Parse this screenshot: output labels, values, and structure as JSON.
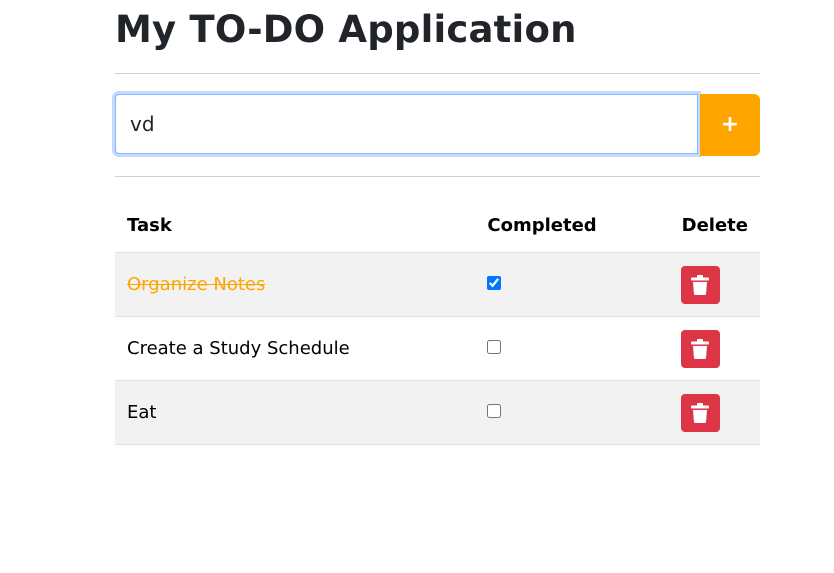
{
  "app": {
    "title": "My TO-DO Application"
  },
  "form": {
    "input_value": "vd",
    "add_label": "+"
  },
  "table": {
    "headers": {
      "task": "Task",
      "completed": "Completed",
      "delete": "Delete"
    },
    "rows": [
      {
        "task": "Organize Notes",
        "completed": true
      },
      {
        "task": "Create a Study Schedule",
        "completed": false
      },
      {
        "task": "Eat",
        "completed": false
      }
    ]
  },
  "colors": {
    "accent": "#ffa500",
    "danger": "#dc3545",
    "stripe": "#f2f2f2"
  },
  "icons": {
    "delete": "trash-icon"
  }
}
